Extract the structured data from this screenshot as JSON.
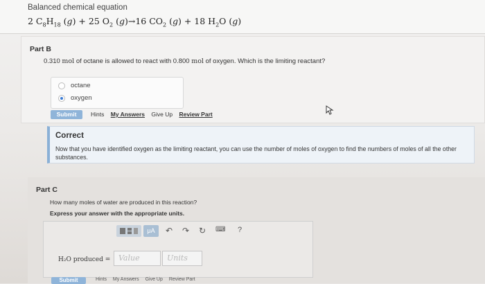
{
  "header": {
    "title": "Balanced chemical equation",
    "equation_html": "2 C<sub>8</sub>H<sub>18</sub> (<i>g</i>) + 25 O<sub>2</sub> (<i>g</i>)→16 CO<sub>2</sub> (<i>g</i>) + 18 H<sub>2</sub>O (<i>g</i>)"
  },
  "part_b": {
    "label": "Part B",
    "question_prefix": "0.310",
    "question_unit1": "mol",
    "question_mid": "of octane is allowed to react with",
    "question_num2": "0.800",
    "question_unit2": "mol",
    "question_suffix": "of oxygen. Which is the limiting reactant?",
    "choices": [
      {
        "label": "octane",
        "selected": false
      },
      {
        "label": "oxygen",
        "selected": true
      }
    ],
    "submit_label": "Submit",
    "links": {
      "hints": "Hints",
      "my_answers": "My Answers",
      "give_up": "Give Up",
      "review_part": "Review Part"
    }
  },
  "feedback": {
    "title": "Correct",
    "text": "Now that you have identified oxygen as the limiting reactant, you can use the number of moles of oxygen to find the numbers of moles of all the other substances."
  },
  "part_c": {
    "label": "Part C",
    "question": "How many moles of water are produced in this reaction?",
    "instruction": "Express your answer with the appropriate units.",
    "toolbar": {
      "units_button": "μA",
      "help": "?"
    },
    "answer_label": "H₂O produced =",
    "value_placeholder": "Value",
    "units_placeholder": "Units",
    "submit_label": "Submit",
    "links": {
      "hints": "Hints",
      "my_answers": "My Answers",
      "give_up": "Give Up",
      "review_part": "Review Part"
    }
  },
  "colors": {
    "accent": "#8fb4d9",
    "feedback_border": "#8ab0d6",
    "radio_selected": "#3a7bd5"
  }
}
